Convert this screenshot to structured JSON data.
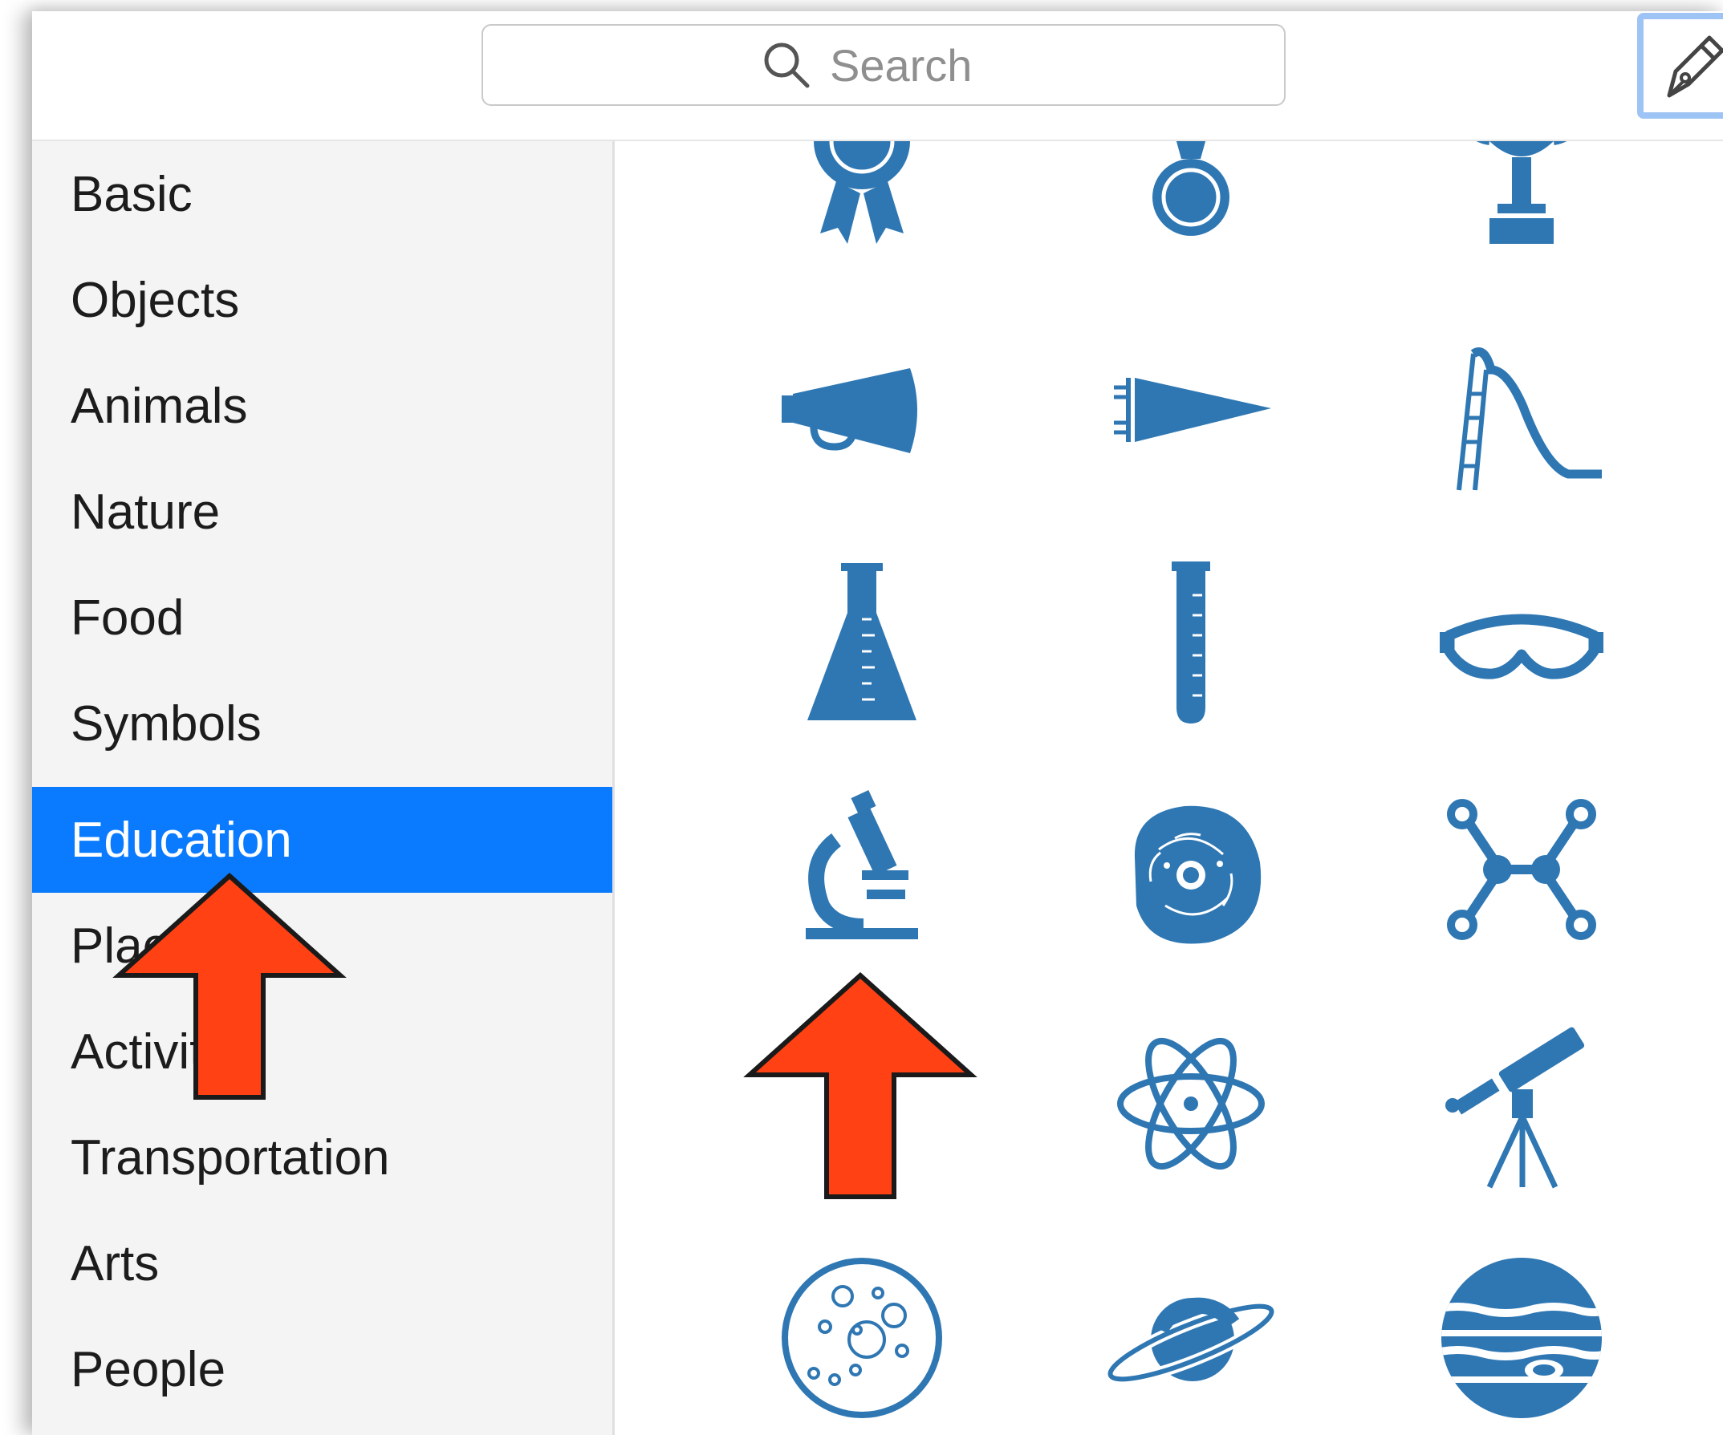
{
  "search": {
    "placeholder": "Search"
  },
  "colors": {
    "accent": "#0a7bff",
    "icon": "#2f77b3",
    "arrow": "#ff4113"
  },
  "sidebar": {
    "items": [
      {
        "label": "Basic"
      },
      {
        "label": "Objects"
      },
      {
        "label": "Animals"
      },
      {
        "label": "Nature"
      },
      {
        "label": "Food"
      },
      {
        "label": "Symbols"
      },
      {
        "label": "Education",
        "selected": true
      },
      {
        "label": "Places"
      },
      {
        "label": "Activities"
      },
      {
        "label": "Transportation"
      },
      {
        "label": "Arts"
      },
      {
        "label": "People"
      }
    ]
  },
  "shapes": [
    "ribbon-award-icon",
    "medal-icon",
    "trophy-icon",
    "megaphone-icon",
    "pennant-flag-icon",
    "playground-slide-icon",
    "erlenmeyer-flask-icon",
    "test-tube-icon",
    "safety-goggles-icon",
    "microscope-icon",
    "cell-icon",
    "molecule-icon",
    "atom-icon",
    "telescope-icon",
    "petri-dish-icon",
    "saturn-planet-icon",
    "jupiter-planet-icon"
  ],
  "toolbar": {
    "pen_tool": "pen-tool-icon"
  }
}
